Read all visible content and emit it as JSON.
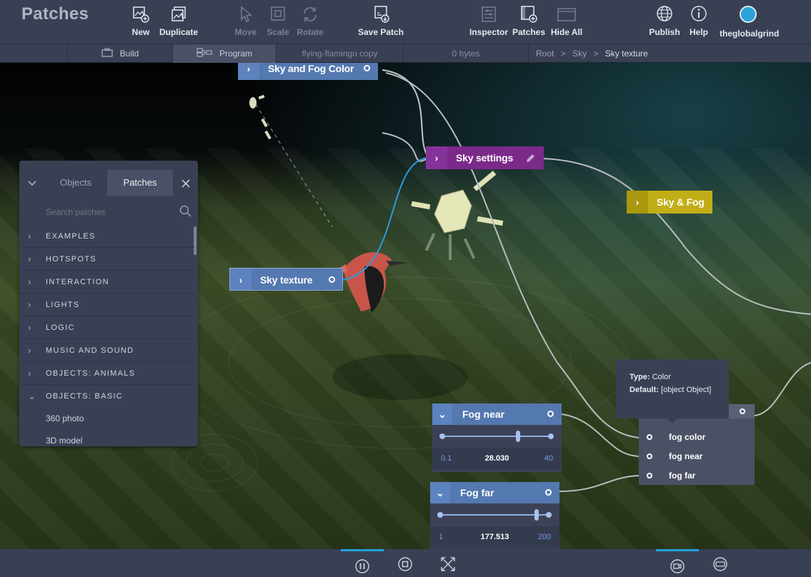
{
  "app": {
    "title": "Patches"
  },
  "toolbar": {
    "new": "New",
    "duplicate": "Duplicate",
    "move": "Move",
    "scale": "Scale",
    "rotate": "Rotate",
    "save_patch": "Save Patch",
    "inspector": "Inspector",
    "patches": "Patches",
    "hide_all": "Hide All",
    "publish": "Publish",
    "help": "Help",
    "user": "theglobalgrind"
  },
  "subbar": {
    "build": "Build",
    "program": "Program",
    "project": "flying-flamingo copy",
    "size": "0 bytes",
    "breadcrumb": [
      "Root",
      "Sky",
      "Sky texture"
    ],
    "separator": ">"
  },
  "nodes": {
    "sky_fog_color": "Sky and Fog Color",
    "sky_settings": "Sky settings",
    "sky_and_fog": "Sky & Fog",
    "sky_texture": "Sky texture"
  },
  "panel": {
    "tabs": [
      "Objects",
      "Patches"
    ],
    "search_placeholder": "Search patches",
    "categories": [
      "EXAMPLES",
      "HOTSPOTS",
      "INTERACTION",
      "LIGHTS",
      "LOGIC",
      "MUSIC AND SOUND",
      "OBJECTS: ANIMALS",
      "OBJECTS: BASIC"
    ],
    "sub_items": [
      "360 photo",
      "3D model"
    ]
  },
  "fog_near": {
    "title": "Fog near",
    "min": "0.1",
    "value": "28.030",
    "max": "40",
    "fraction": 0.7
  },
  "fog_far": {
    "title": "Fog far",
    "min": "1",
    "value": "177.513",
    "max": "200",
    "fraction": 0.885
  },
  "tooltip": {
    "type_label": "Type:",
    "type_value": "Color",
    "default_label": "Default:",
    "default_value": "[object Object]"
  },
  "sky_fog_inputs": [
    "fog color",
    "fog near",
    "fog far"
  ],
  "colors": {
    "toolbar_bg": "#3a4054",
    "sky_fog_color_node": "#5478b0",
    "sky_settings_node": "#7b2a8a",
    "sky_and_fog_node": "#c2ad16",
    "sky_texture_node": "#5478b0",
    "selection_accent": "#1fa3d8",
    "wire_blue": "#2d9ae0"
  }
}
